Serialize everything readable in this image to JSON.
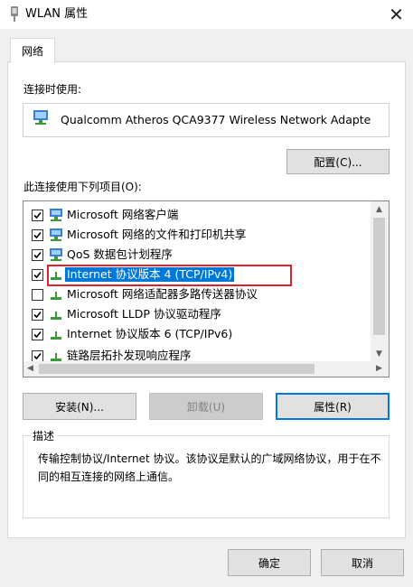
{
  "window": {
    "title": "WLAN 属性",
    "close_glyph": "✕"
  },
  "tabs": [
    {
      "label": "网络"
    }
  ],
  "connect_using": {
    "label": "连接时使用:",
    "adapter_name": "Qualcomm Atheros QCA9377 Wireless Network Adapte"
  },
  "buttons": {
    "configure": "配置(C)...",
    "install": "安装(N)...",
    "uninstall": "卸载(U)",
    "properties": "属性(R)",
    "ok": "确定",
    "cancel": "取消"
  },
  "items_label": "此连接使用下列项目(O):",
  "items": [
    {
      "label": "Microsoft 网络客户端",
      "checked": true,
      "icon": "network-client-icon"
    },
    {
      "label": "Microsoft 网络的文件和打印机共享",
      "checked": true,
      "icon": "network-client-icon"
    },
    {
      "label": "QoS 数据包计划程序",
      "checked": true,
      "icon": "network-client-icon"
    },
    {
      "label": "Internet 协议版本 4 (TCP/IPv4)",
      "checked": true,
      "icon": "protocol-icon",
      "selected": true
    },
    {
      "label": "Microsoft 网络适配器多路传送器协议",
      "checked": false,
      "icon": "protocol-icon"
    },
    {
      "label": "Microsoft LLDP 协议驱动程序",
      "checked": true,
      "icon": "protocol-icon"
    },
    {
      "label": "Internet 协议版本 6 (TCP/IPv6)",
      "checked": true,
      "icon": "protocol-icon"
    },
    {
      "label": "链路层拓扑发现响应程序",
      "checked": true,
      "icon": "protocol-icon"
    }
  ],
  "description": {
    "title": "描述",
    "text": "传输控制协议/Internet 协议。该协议是默认的广域网络协议，用于在不同的相互连接的网络上通信。"
  },
  "colors": {
    "selection": "#0078d7",
    "highlight_box": "#e0212b",
    "default_button_border": "#0078d7"
  }
}
